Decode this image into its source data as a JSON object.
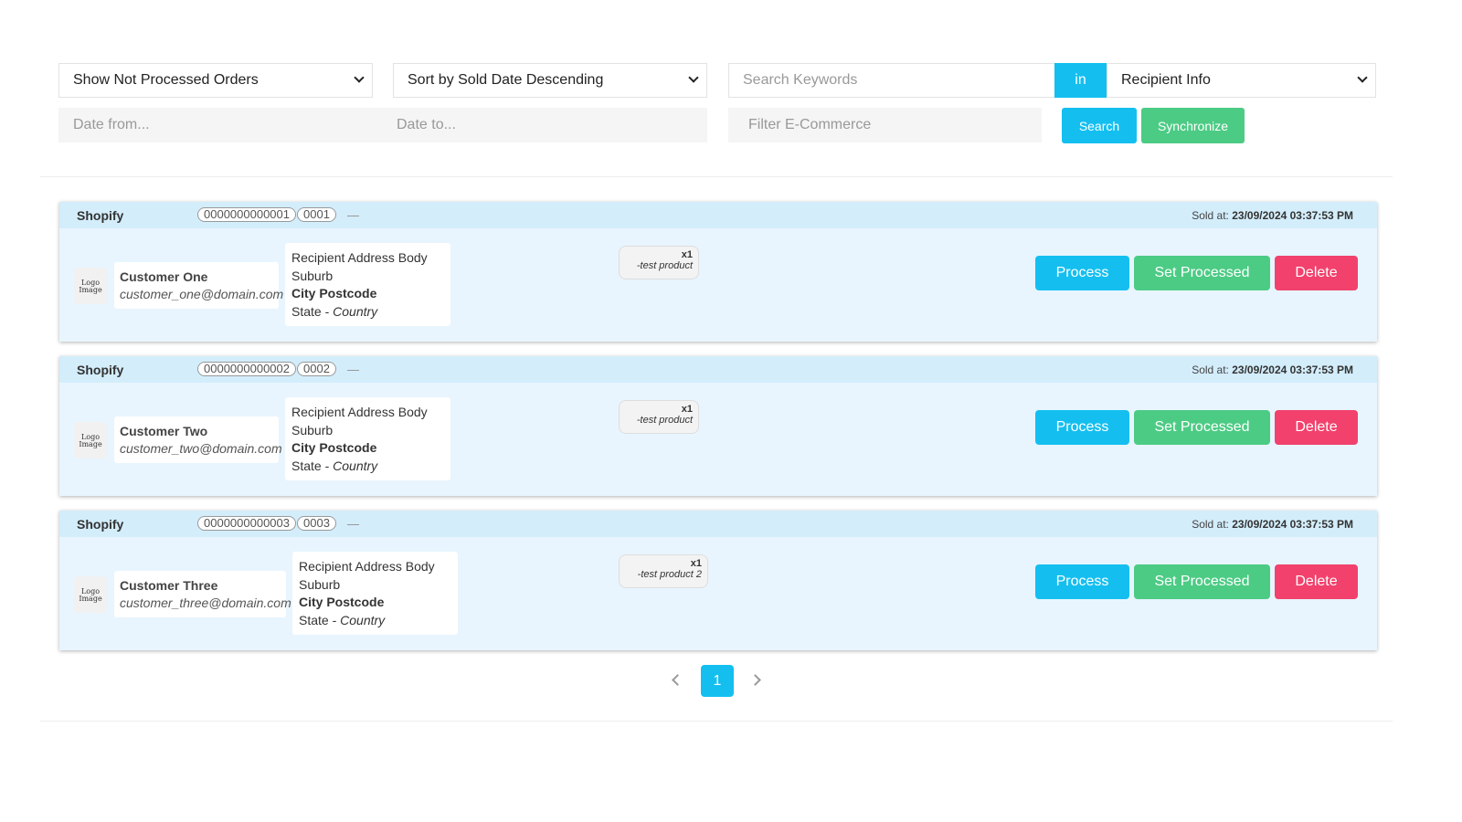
{
  "filters": {
    "status": "Show Not Processed Orders",
    "sort": "Sort by Sold Date Descending",
    "search_placeholder": "Search Keywords",
    "in_label": "in",
    "search_field": "Recipient Info",
    "date_from_placeholder": "Date from...",
    "date_to_placeholder": "Date to...",
    "ecommerce_placeholder": "Filter E-Commerce",
    "search_button": "Search",
    "sync_button": "Synchronize"
  },
  "colors": {
    "primary": "#14bff0",
    "success": "#4ccb84",
    "danger": "#f1416c",
    "card_header": "#d3edfb",
    "card_body": "#e8f5fe"
  },
  "orders": [
    {
      "platform": "Shopify",
      "order_id": "0000000000001",
      "order_no": "0001",
      "sold_label": "Sold at:",
      "sold_at": "23/09/2024 03:37:53 PM",
      "logo": "Logo Image",
      "customer_name": "Customer One",
      "customer_email": "customer_one@domain.com",
      "address_body": "Recipient Address Body",
      "suburb": "Suburb",
      "city_postcode": "City Postcode",
      "state": "State - ",
      "country": "Country",
      "qty": "x1",
      "product": "-test product",
      "process": "Process",
      "set_processed": "Set Processed",
      "delete": "Delete"
    },
    {
      "platform": "Shopify",
      "order_id": "0000000000002",
      "order_no": "0002",
      "sold_label": "Sold at:",
      "sold_at": "23/09/2024 03:37:53 PM",
      "logo": "Logo Image",
      "customer_name": "Customer Two",
      "customer_email": "customer_two@domain.com",
      "address_body": "Recipient Address Body",
      "suburb": "Suburb",
      "city_postcode": "City Postcode",
      "state": "State - ",
      "country": "Country",
      "qty": "x1",
      "product": "-test product",
      "process": "Process",
      "set_processed": "Set Processed",
      "delete": "Delete"
    },
    {
      "platform": "Shopify",
      "order_id": "0000000000003",
      "order_no": "0003",
      "sold_label": "Sold at:",
      "sold_at": "23/09/2024 03:37:53 PM",
      "logo": "Logo Image",
      "customer_name": "Customer Three",
      "customer_email": "customer_three@domain.com",
      "address_body": "Recipient Address Body",
      "suburb": "Suburb",
      "city_postcode": "City Postcode",
      "state": "State - ",
      "country": "Country",
      "qty": "x1",
      "product": "-test product 2",
      "process": "Process",
      "set_processed": "Set Processed",
      "delete": "Delete"
    }
  ],
  "pagination": {
    "current": "1",
    "prev_icon": "chevron-left",
    "next_icon": "chevron-right"
  }
}
